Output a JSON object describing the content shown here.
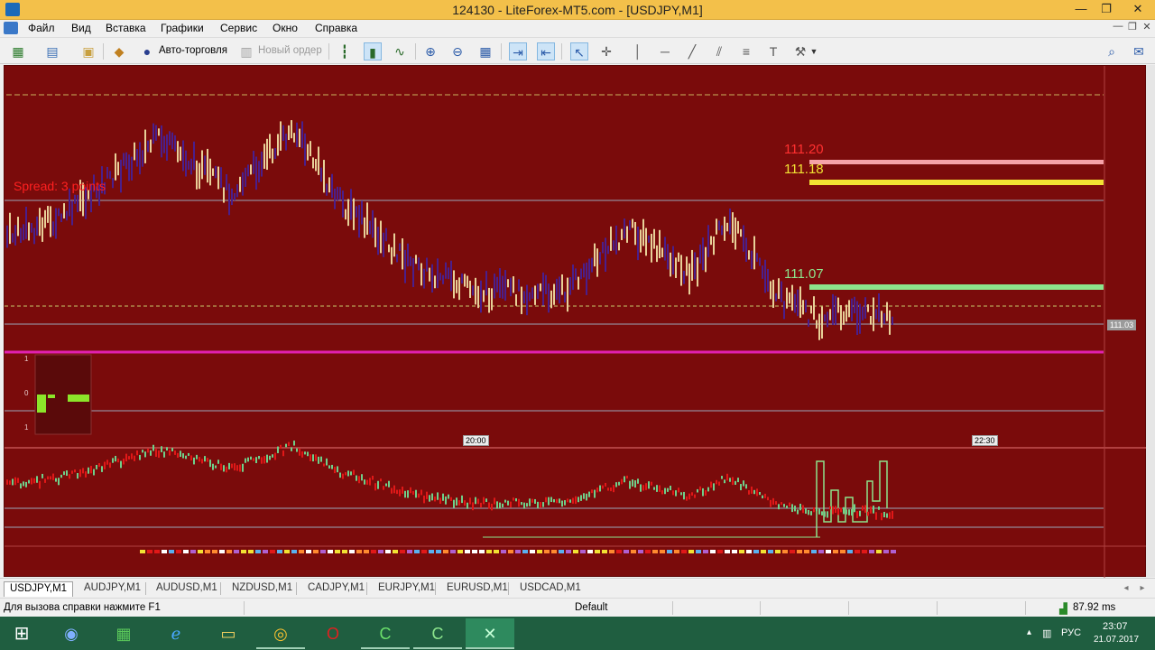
{
  "window": {
    "title": "124130 - LiteForex-MT5.com - [USDJPY,M1]",
    "buttons": [
      "—",
      "❐",
      "✕"
    ]
  },
  "menu": {
    "items": [
      "Файл",
      "Вид",
      "Вставка",
      "Графики",
      "Сервис",
      "Окно",
      "Справка"
    ],
    "mdi_buttons": [
      "—",
      "❐",
      "✕"
    ]
  },
  "toolbar": {
    "auto_trading_label": "Авто-торговля",
    "new_order_label": "Новый ордер"
  },
  "chart": {
    "price_labels": {
      "ask": "111.20",
      "bid": "111.18",
      "level": "111.07"
    },
    "current_price_tag": "111.03",
    "spread_text": "Spread: 3 points",
    "time_tags": [
      "20:00",
      "22:30"
    ],
    "indicator_levels": [
      "1",
      "0",
      "1"
    ],
    "colors": {
      "background": "#7a0b0b",
      "ask_line": "#f6a2a8",
      "bid_line": "#f2e233",
      "level_line": "#8ce58c",
      "support_line": "#e020b0",
      "bars_up": "#e8d098",
      "bars_down": "#4a1f8c"
    }
  },
  "tabs": {
    "items": [
      "USDJPY,M1",
      "AUDJPY,M1",
      "AUDUSD,M1",
      "NZDUSD,M1",
      "CADJPY,M1",
      "EURJPY,M1",
      "EURUSD,M1",
      "USDCAD,M1"
    ],
    "active": "USDJPY,M1"
  },
  "status": {
    "help": "Для вызова справки нажмите F1",
    "profile": "Default",
    "ping": "87.92 ms"
  },
  "taskbar": {
    "lang": "РУС",
    "time": "23:07",
    "date": "21.07.2017"
  }
}
